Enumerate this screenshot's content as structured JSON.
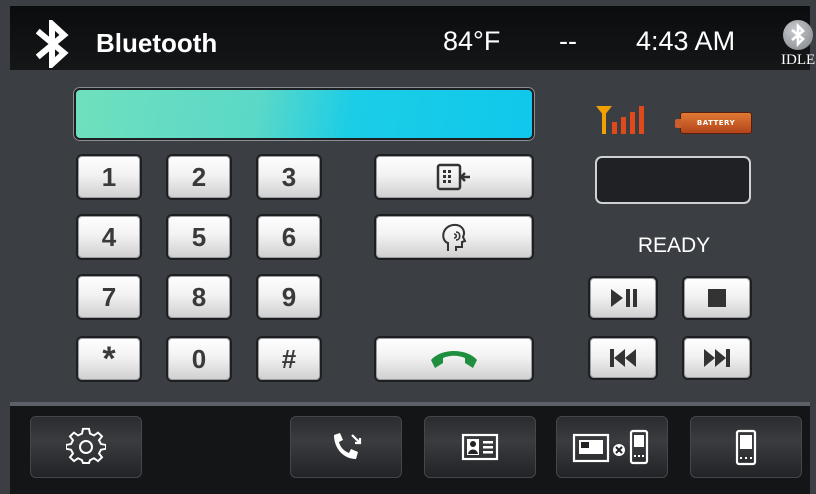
{
  "header": {
    "title": "Bluetooth",
    "temperature": "84°F",
    "separator": "--",
    "time": "4:43 AM",
    "bt_state": "IDLE"
  },
  "display": {
    "number": ""
  },
  "keypad": {
    "keys": [
      "1",
      "2",
      "3",
      "4",
      "5",
      "6",
      "7",
      "8",
      "9",
      "*",
      "0",
      "#"
    ]
  },
  "actions": {
    "transfer_icon": "phone-transfer-icon",
    "voice_icon": "voice-dial-icon",
    "call_icon": "call-handset-icon"
  },
  "status": {
    "signal_icon": "signal-strength-icon",
    "battery_label": "BATTERY",
    "caller": "",
    "state": "READY"
  },
  "media": {
    "buttons": [
      "play-pause",
      "stop",
      "previous",
      "next"
    ]
  },
  "bottom_tabs": [
    "settings",
    "call-log",
    "contacts",
    "disconnect-device",
    "phone-device"
  ],
  "colors": {
    "display_start": "#6fe0bd",
    "display_end": "#0fc8ec",
    "call_green": "#1f8f3f",
    "battery": "#d0602a",
    "signal": "#f0a000"
  }
}
